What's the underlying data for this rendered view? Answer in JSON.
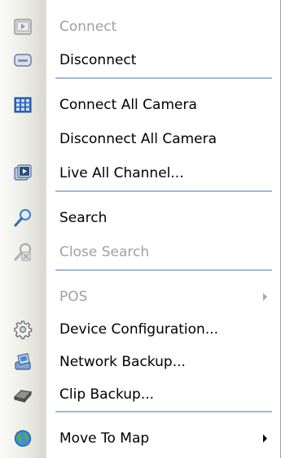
{
  "menu": {
    "items": [
      {
        "label": "Connect",
        "icon": "connect-icon",
        "enabled": false
      },
      {
        "label": "Disconnect",
        "icon": "disconnect-icon",
        "enabled": true
      },
      {
        "label": "Connect All Camera",
        "icon": "camera-grid-icon",
        "enabled": true
      },
      {
        "label": "Disconnect All Camera",
        "icon": "",
        "enabled": true
      },
      {
        "label": "Live All Channel...",
        "icon": "live-channel-icon",
        "enabled": true
      },
      {
        "label": "Search",
        "icon": "search-icon",
        "enabled": true
      },
      {
        "label": "Close Search",
        "icon": "close-search-icon",
        "enabled": false
      },
      {
        "label": "POS",
        "icon": "",
        "enabled": false,
        "submenu": true
      },
      {
        "label": "Device Configuration...",
        "icon": "gear-icon",
        "enabled": true
      },
      {
        "label": "Network Backup...",
        "icon": "network-backup-icon",
        "enabled": true
      },
      {
        "label": "Clip Backup...",
        "icon": "clip-backup-icon",
        "enabled": true
      },
      {
        "label": "Move To Map",
        "icon": "globe-icon",
        "enabled": true,
        "submenu": true
      }
    ]
  },
  "colors": {
    "separator": "#a4b8d6",
    "disabled_text": "#a0a0a0",
    "text": "#000000"
  }
}
